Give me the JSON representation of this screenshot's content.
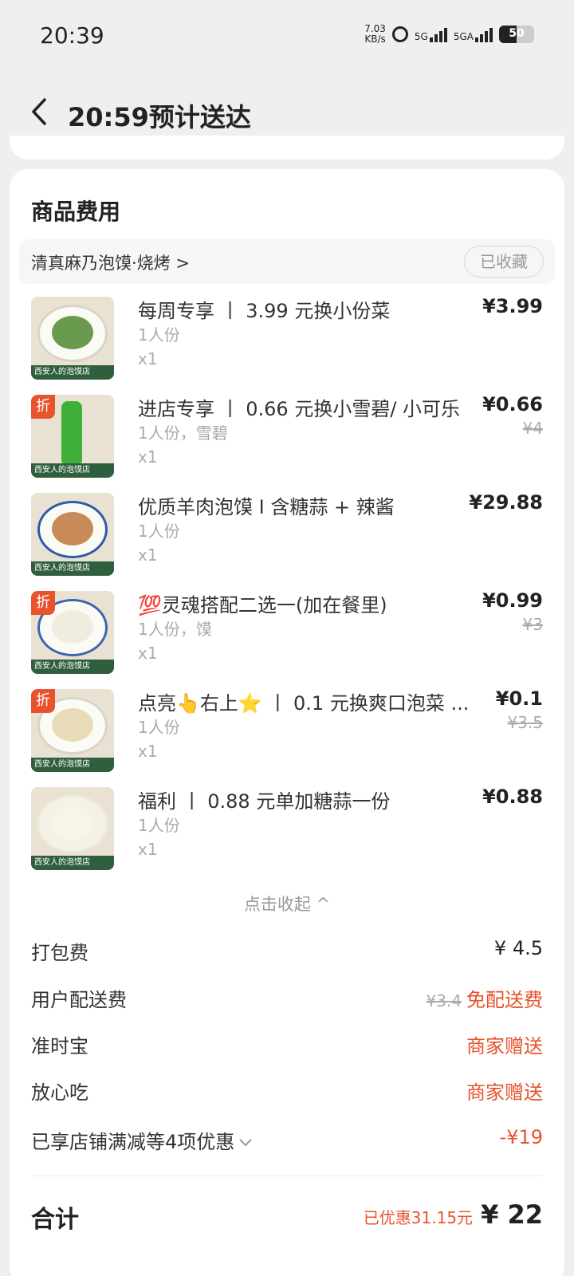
{
  "status": {
    "time": "20:39",
    "net_speed_value": "7.03",
    "net_speed_unit": "KB/s",
    "sig1": "5G",
    "sig2": "5GA",
    "battery": "50",
    "battery_level": 50
  },
  "header": {
    "back_icon": "chevron-left-icon",
    "title": "20:59预计送达"
  },
  "section": {
    "title": "商品费用"
  },
  "shop": {
    "name": "清真麻乃泡馍·烧烤 >",
    "fav_label": "已收藏"
  },
  "items": [
    {
      "name": "每周专享 丨 3.99 元换小份菜",
      "spec": "1人份",
      "qty": "x1",
      "price": "¥3.99",
      "orig": "",
      "discount": "",
      "thumb_label": "西安人的泡馍店"
    },
    {
      "name": "进店专享 丨 0.66 元换小雪碧/ 小可乐",
      "spec": "1人份，雪碧",
      "qty": "x1",
      "price": "¥0.66",
      "orig": "¥4",
      "discount": "折",
      "thumb_label": "西安人的泡馍店"
    },
    {
      "name": "优质羊肉泡馍 I 含糖蒜 + 辣酱",
      "spec": "1人份",
      "qty": "x1",
      "price": "¥29.88",
      "orig": "",
      "discount": "",
      "thumb_label": "西安人的泡馍店"
    },
    {
      "name": "💯灵魂搭配二选一(加在餐里)",
      "spec": "1人份，馍",
      "qty": "x1",
      "price": "¥0.99",
      "orig": "¥3",
      "discount": "折",
      "thumb_label": "西安人的泡馍店"
    },
    {
      "name": "点亮👆右上⭐ 丨 0.1 元换爽口泡菜 ...",
      "spec": "1人份",
      "qty": "x1",
      "price": "¥0.1",
      "orig": "¥3.5",
      "discount": "折",
      "thumb_label": "西安人的泡馍店"
    },
    {
      "name": "福利 丨 0.88 元单加糖蒜一份",
      "spec": "1人份",
      "qty": "x1",
      "price": "¥0.88",
      "orig": "",
      "discount": "",
      "thumb_label": "西安人的泡馍店"
    }
  ],
  "collapse_label": "点击收起 ^",
  "fees": {
    "packing": {
      "label": "打包费",
      "value": "¥ 4.5"
    },
    "delivery": {
      "label": "用户配送费",
      "orig": "¥3.4",
      "value": "免配送费"
    },
    "ontime": {
      "label": "准时宝",
      "value": "商家赠送"
    },
    "safe": {
      "label": "放心吃",
      "value": "商家赠送"
    },
    "discount": {
      "label": "已享店铺满减等4项优惠",
      "value": "-¥19"
    }
  },
  "total": {
    "label": "合计",
    "saved": "已优惠31.15元",
    "value": "¥ 22"
  }
}
